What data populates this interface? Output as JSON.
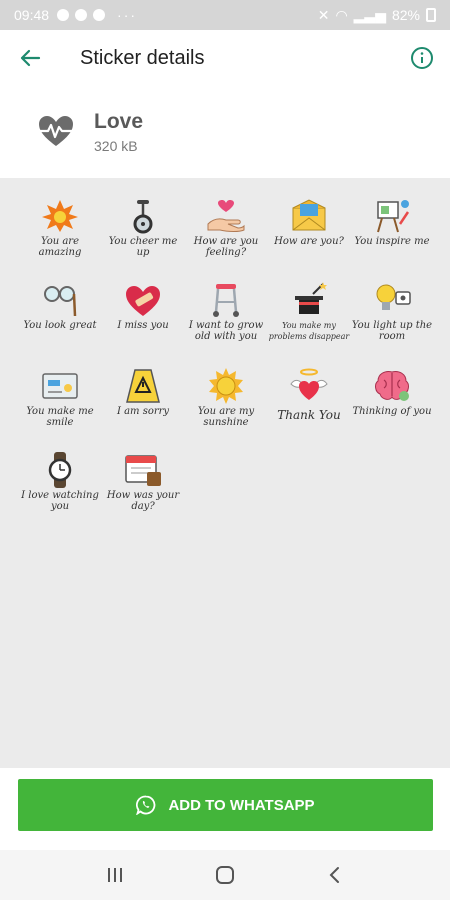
{
  "status_bar": {
    "time": "09:48",
    "battery": "82%"
  },
  "app_bar": {
    "title": "Sticker details"
  },
  "pack": {
    "name": "Love",
    "size": "320 kB"
  },
  "stickers": [
    {
      "caption": "You are amazing",
      "icon": "explosion-icon"
    },
    {
      "caption": "You cheer me up",
      "icon": "unicycle-icon"
    },
    {
      "caption": "How are you feeling?",
      "icon": "hand-heart-icon"
    },
    {
      "caption": "How are you?",
      "icon": "envelope-icon"
    },
    {
      "caption": "You inspire me",
      "icon": "easel-icon"
    },
    {
      "caption": "You look great",
      "icon": "glasses-icon"
    },
    {
      "caption": "I miss you",
      "icon": "bandaged-heart-icon"
    },
    {
      "caption": "I want to grow old with you",
      "icon": "walker-icon"
    },
    {
      "caption": "You make my problems disappear",
      "icon": "magic-hat-icon"
    },
    {
      "caption": "You light up the room",
      "icon": "lightbulb-icon"
    },
    {
      "caption": "You make me smile",
      "icon": "gift-card-icon"
    },
    {
      "caption": "I am sorry",
      "icon": "wet-floor-sign-icon"
    },
    {
      "caption": "You are my sunshine",
      "icon": "sun-icon"
    },
    {
      "caption": "Thank You",
      "icon": "angel-heart-icon"
    },
    {
      "caption": "Thinking of you",
      "icon": "brain-icon"
    },
    {
      "caption": "I love watching you",
      "icon": "watch-icon"
    },
    {
      "caption": "How was your day?",
      "icon": "calendar-icon"
    }
  ],
  "action": {
    "label": "ADD TO WHATSAPP"
  },
  "colors": {
    "accent": "#1e8a6e",
    "button": "#43b53a",
    "grid_bg": "#ebebeb"
  }
}
